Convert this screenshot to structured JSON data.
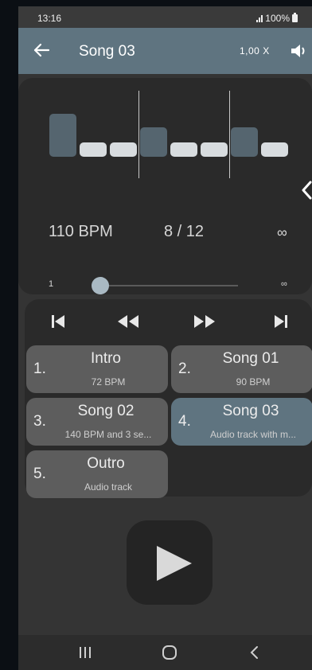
{
  "status_bar": {
    "time": "13:16",
    "battery": "100%"
  },
  "app_bar": {
    "title": "Song 03",
    "speed": "1,00 X"
  },
  "beat_display": {
    "beats": [
      "accent",
      "normal",
      "normal",
      "accent",
      "normal",
      "normal",
      "accent",
      "normal"
    ],
    "bpm": "110 BPM",
    "beat_counter": "8 / 12",
    "repeat_label": "∞"
  },
  "slider": {
    "min_label": "1",
    "max_label": "∞",
    "value": 1
  },
  "playlist": [
    {
      "number": "1.",
      "name": "Intro",
      "detail": "72 BPM",
      "active": false
    },
    {
      "number": "2.",
      "name": "Song 01",
      "detail": "90 BPM",
      "active": false
    },
    {
      "number": "3.",
      "name": "Song 02",
      "detail": "140 BPM and 3 se...",
      "active": false
    },
    {
      "number": "4.",
      "name": "Song 03",
      "detail": "Audio track with m...",
      "active": true
    },
    {
      "number": "5.",
      "name": "Outro",
      "detail": "Audio track",
      "active": false
    }
  ],
  "colors": {
    "accent": "#5f7480",
    "background": "#343434",
    "card": "#2a2a2a"
  }
}
